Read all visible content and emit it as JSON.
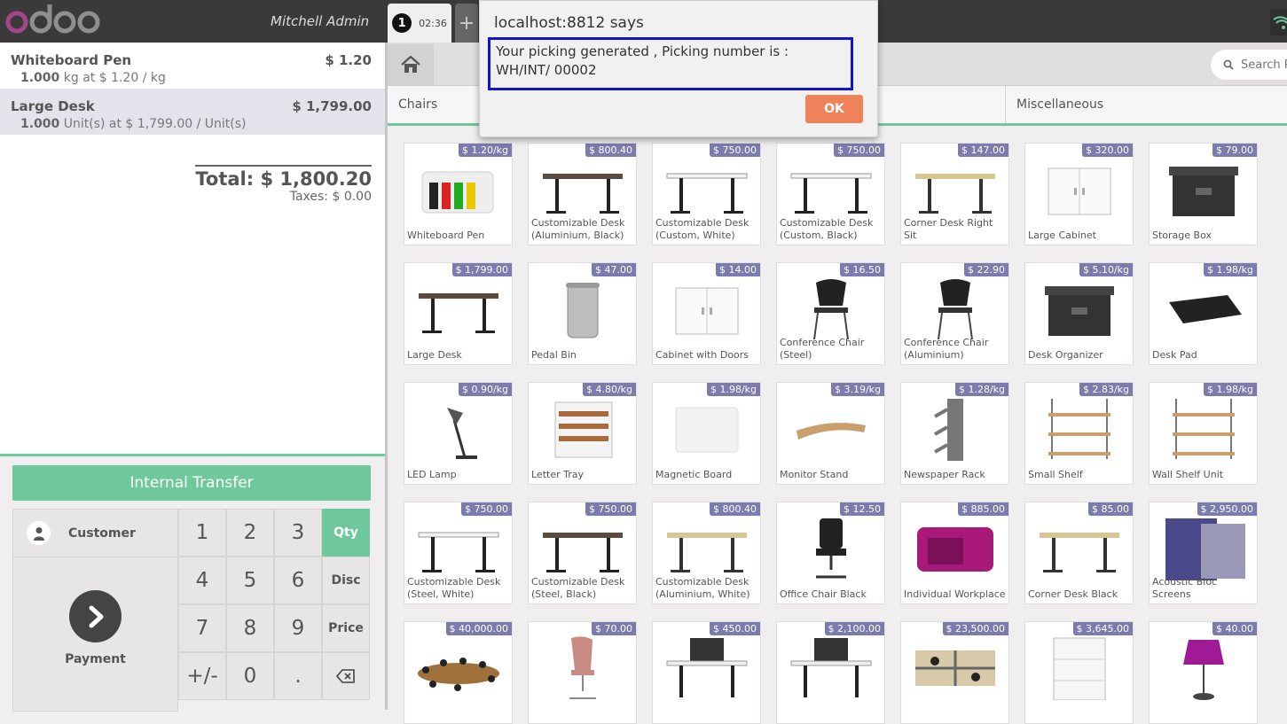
{
  "header": {
    "user": "Mitchell Admin",
    "order_number": "1",
    "order_time": "02:36",
    "new_order": "+"
  },
  "order": {
    "lines": [
      {
        "name": "Whiteboard Pen",
        "price": "$ 1.20",
        "qty": "1.000",
        "detail": "kg at $ 1.20 / kg"
      },
      {
        "name": "Large Desk",
        "price": "$ 1,799.00",
        "qty": "1.000",
        "detail": "Unit(s) at $ 1,799.00 / Unit(s)"
      }
    ],
    "total": "Total: $ 1,800.20",
    "taxes": "Taxes: $ 0.00"
  },
  "pad": {
    "transfer": "Internal Transfer",
    "customer": "Customer",
    "payment": "Payment",
    "keys": [
      "1",
      "2",
      "3",
      "Qty",
      "4",
      "5",
      "6",
      "Disc",
      "7",
      "8",
      "9",
      "Price",
      "+/-",
      "0",
      "."
    ]
  },
  "search": {
    "placeholder": "Search P"
  },
  "categories": {
    "chairs": "Chairs",
    "misc": "Miscellaneous"
  },
  "products": [
    {
      "name": "Whiteboard Pen",
      "price": "$ 1.20/kg",
      "icon": "pens"
    },
    {
      "name": "Customizable Desk (Aluminium, Black)",
      "price": "$ 800.40",
      "icon": "desk-dark"
    },
    {
      "name": "Customizable Desk (Custom, White)",
      "price": "$ 750.00",
      "icon": "desk-white"
    },
    {
      "name": "Customizable Desk (Custom, Black)",
      "price": "$ 750.00",
      "icon": "desk-white"
    },
    {
      "name": "Corner Desk Right Sit",
      "price": "$ 147.00",
      "icon": "desk-wood"
    },
    {
      "name": "Large Cabinet",
      "price": "$ 320.00",
      "icon": "cabinet"
    },
    {
      "name": "Storage Box",
      "price": "$ 79.00",
      "icon": "box"
    },
    {
      "name": "Large Desk",
      "price": "$ 1,799.00",
      "icon": "desk-dark"
    },
    {
      "name": "Pedal Bin",
      "price": "$ 47.00",
      "icon": "bin"
    },
    {
      "name": "Cabinet with Doors",
      "price": "$ 14.00",
      "icon": "cabinet"
    },
    {
      "name": "Conference Chair (Steel)",
      "price": "$ 16.50",
      "icon": "chair"
    },
    {
      "name": "Conference Chair (Aluminium)",
      "price": "$ 22.90",
      "icon": "chair"
    },
    {
      "name": "Desk Organizer",
      "price": "$ 5.10/kg",
      "icon": "box"
    },
    {
      "name": "Desk Pad",
      "price": "$ 1.98/kg",
      "icon": "pad"
    },
    {
      "name": "LED Lamp",
      "price": "$ 0.90/kg",
      "icon": "lamp"
    },
    {
      "name": "Letter Tray",
      "price": "$ 4.80/kg",
      "icon": "tray"
    },
    {
      "name": "Magnetic Board",
      "price": "$ 1.98/kg",
      "icon": "board"
    },
    {
      "name": "Monitor Stand",
      "price": "$ 3.19/kg",
      "icon": "stand"
    },
    {
      "name": "Newspaper Rack",
      "price": "$ 1.28/kg",
      "icon": "rack"
    },
    {
      "name": "Small Shelf",
      "price": "$ 2.83/kg",
      "icon": "shelf"
    },
    {
      "name": "Wall Shelf Unit",
      "price": "$ 1.98/kg",
      "icon": "shelf"
    },
    {
      "name": "Customizable Desk (Steel, White)",
      "price": "$ 750.00",
      "icon": "desk-white"
    },
    {
      "name": "Customizable Desk (Steel, Black)",
      "price": "$ 750.00",
      "icon": "desk-dark"
    },
    {
      "name": "Customizable Desk (Aluminium, White)",
      "price": "$ 800.40",
      "icon": "desk-wood"
    },
    {
      "name": "Office Chair Black",
      "price": "$ 12.50",
      "icon": "office-chair"
    },
    {
      "name": "Individual Workplace",
      "price": "$ 885.00",
      "icon": "booth"
    },
    {
      "name": "Corner Desk Black",
      "price": "$ 85.00",
      "icon": "desk-wood"
    },
    {
      "name": "Acoustic Bloc Screens",
      "price": "$ 2,950.00",
      "icon": "screen"
    },
    {
      "name": "",
      "price": "$ 40,000.00",
      "icon": "table"
    },
    {
      "name": "",
      "price": "$ 70.00",
      "icon": "pink-chair"
    },
    {
      "name": "",
      "price": "$ 450.00",
      "icon": "desk-screen"
    },
    {
      "name": "",
      "price": "$ 2,100.00",
      "icon": "desk-screen"
    },
    {
      "name": "",
      "price": "$ 23,500.00",
      "icon": "workstations"
    },
    {
      "name": "",
      "price": "$ 3,645.00",
      "icon": "drawers"
    },
    {
      "name": "",
      "price": "$ 40.00",
      "icon": "purple-lamp"
    }
  ],
  "dialog": {
    "title": "localhost:8812 says",
    "message": "Your picking generated , Picking number is : WH/INT/ 00002",
    "ok": "OK"
  },
  "colors": {
    "accent": "#6ec89b",
    "price_badge": "#7c7bad",
    "ok_button": "#f0825a",
    "highlight": "#1414d2"
  }
}
